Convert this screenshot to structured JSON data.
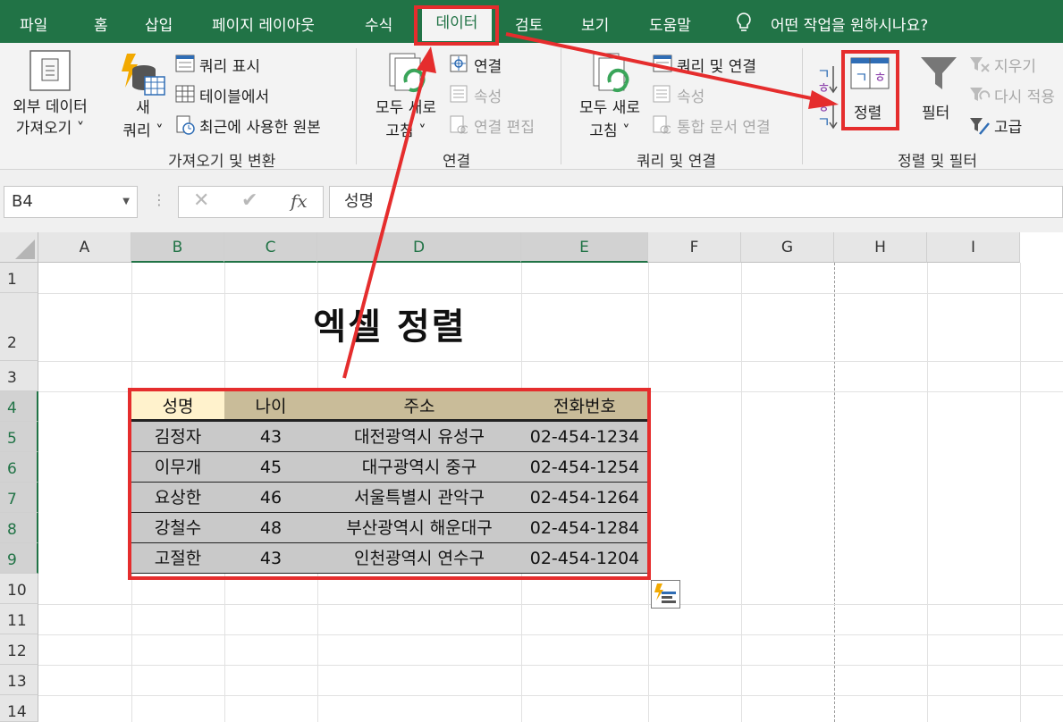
{
  "menu": {
    "tabs": [
      "파일",
      "홈",
      "삽입",
      "페이지 레이아웃",
      "수식",
      "데이터",
      "검토",
      "보기",
      "도움말"
    ],
    "active_tab": "데이터",
    "tell_me": "어떤 작업을 원하시나요?"
  },
  "ribbon": {
    "get_transform": {
      "external_data": [
        "외부 데이터",
        "가져오기 ˅"
      ],
      "new_query": [
        "새",
        "쿼리 ˅"
      ],
      "show_queries": "쿼리 표시",
      "from_table": "테이블에서",
      "recent_sources": "최근에 사용한 원본",
      "title": "가져오기 및 변환"
    },
    "connections": {
      "refresh_all": [
        "모두 새로",
        "고침 ˅"
      ],
      "connections": "연결",
      "properties": "속성",
      "edit_links": "연결 편집",
      "title": "연결"
    },
    "queries_connections": {
      "refresh_all": [
        "모두 새로",
        "고침 ˅"
      ],
      "queries_connections": "쿼리 및 연결",
      "properties": "속성",
      "workbook_links": "통합 문서 연결",
      "title": "쿼리 및 연결"
    },
    "sort_filter": {
      "sort": "정렬",
      "filter": "필터",
      "clear": "지우기",
      "reapply": "다시 적용",
      "advanced": "고급",
      "title": "정렬 및 필터"
    }
  },
  "formula_bar": {
    "name_box": "B4",
    "fx": "fx",
    "content": "성명"
  },
  "sheet": {
    "columns": [
      "A",
      "B",
      "C",
      "D",
      "E",
      "F",
      "G",
      "H",
      "I"
    ],
    "rows": [
      "1",
      "2",
      "3",
      "4",
      "5",
      "6",
      "7",
      "8",
      "9",
      "10",
      "11",
      "12",
      "13",
      "14"
    ],
    "title": "엑셀 정렬",
    "table_headers": [
      "성명",
      "나이",
      "주소",
      "전화번호"
    ],
    "table_rows": [
      [
        "김정자",
        "43",
        "대전광역시 유성구",
        "02-454-1234"
      ],
      [
        "이무개",
        "45",
        "대구광역시 중구",
        "02-454-1254"
      ],
      [
        "요상한",
        "46",
        "서울특별시 관악구",
        "02-454-1264"
      ],
      [
        "강철수",
        "48",
        "부산광역시 해운대구",
        "02-454-1284"
      ],
      [
        "고절한",
        "43",
        "인천광역시 연수구",
        "02-454-1204"
      ]
    ]
  },
  "colors": {
    "excel_green": "#217346",
    "highlight_red": "#e52d2d",
    "table_header": "#c9bc99",
    "table_body": "#c9c9c9",
    "active_cell": "#fff2cc"
  }
}
